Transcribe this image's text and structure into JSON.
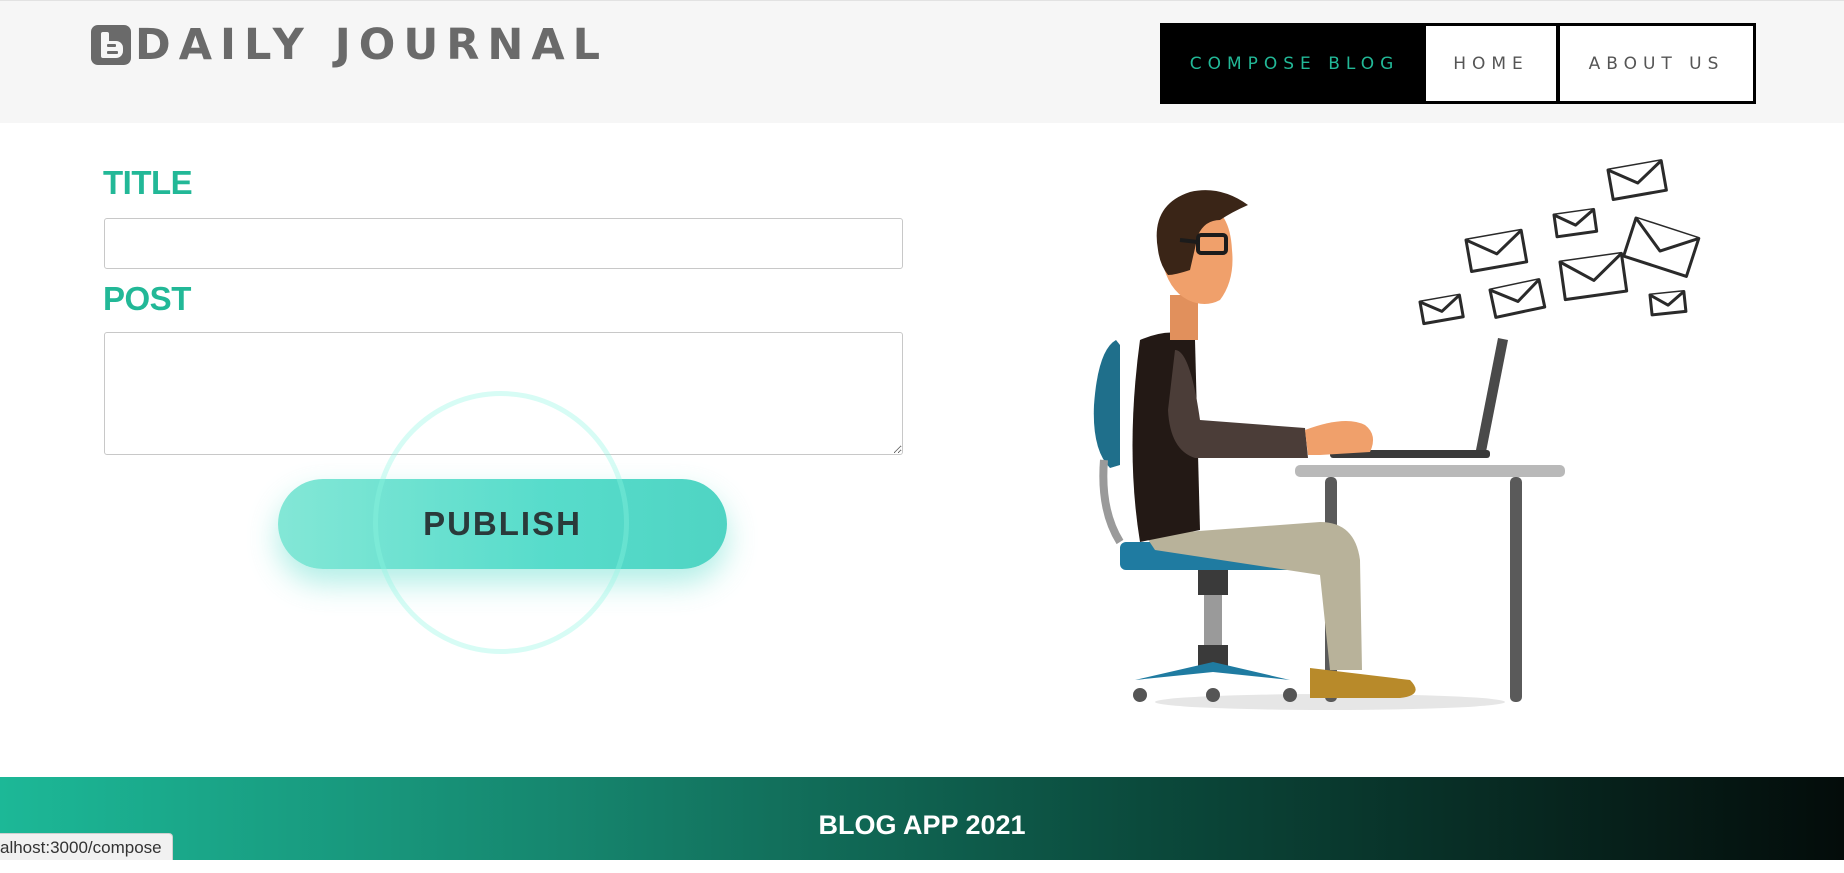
{
  "header": {
    "brand": "DAILY JOURNAL",
    "brand_icon": "blogger-icon",
    "nav": [
      {
        "label": "COMPOSE BLOG",
        "active": true
      },
      {
        "label": "HOME",
        "active": false
      },
      {
        "label": "ABOUT US",
        "active": false
      }
    ]
  },
  "form": {
    "title_label": "TITLE",
    "title_value": "",
    "post_label": "POST",
    "post_value": "",
    "publish_label": "PUBLISH"
  },
  "illustration": "person-typing-on-laptop-with-flying-envelopes",
  "footer": {
    "text": "BLOG APP 2021"
  },
  "status_bar": {
    "url": "alhost:3000/compose"
  },
  "colors": {
    "accent": "#22b897",
    "header_bg": "#f6f6f6",
    "nav_active_bg": "#000000",
    "publish_bg": "#57dccb",
    "brand_text": "#6a6a6a"
  }
}
